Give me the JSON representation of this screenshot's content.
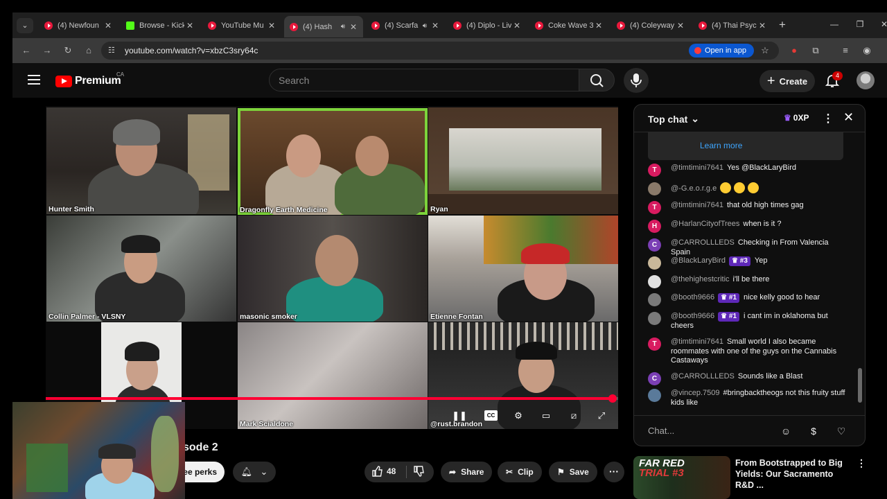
{
  "browser": {
    "tabs": [
      {
        "title": "(4) Newfoun",
        "favicon": "youtube-icon",
        "audio": false
      },
      {
        "title": "Browse - Kick",
        "favicon": "kick-icon",
        "audio": false
      },
      {
        "title": "YouTube Mu",
        "favicon": "youtube-music-icon",
        "audio": false
      },
      {
        "title": "(4) Hash",
        "favicon": "youtube-icon",
        "audio": true,
        "active": true
      },
      {
        "title": "(4) Scarfa",
        "favicon": "youtube-icon",
        "audio": true
      },
      {
        "title": "(4) Diplo - Liv",
        "favicon": "youtube-icon",
        "audio": false
      },
      {
        "title": "Coke Wave 3",
        "favicon": "youtube-music-icon",
        "audio": false
      },
      {
        "title": "(4) Coleyway",
        "favicon": "youtube-icon",
        "audio": false
      },
      {
        "title": "(4) Thai Psych",
        "favicon": "youtube-icon",
        "audio": false
      }
    ],
    "url": "youtube.com/watch?v=xbzC3sry64c",
    "open_in_app": "Open in app"
  },
  "youtube": {
    "logo_text": "Premium",
    "country_code": "CA",
    "search_placeholder": "Search",
    "create_label": "Create",
    "notification_count": "4"
  },
  "video": {
    "participants": [
      "Hunter Smith",
      "Dragonfly Earth Medicine",
      "Ryan",
      "Collin Palmer - VLSNY",
      "masonic smoker",
      "Etienne Fontan",
      "Mark Scialdone",
      "@rust.brandon"
    ],
    "progress_percent": 99,
    "cc_label": "CC",
    "title_fragment": "sode 2"
  },
  "actions": {
    "perks_label": "ee perks",
    "like_count": "48",
    "share_label": "Share",
    "clip_label": "Clip",
    "save_label": "Save"
  },
  "chat": {
    "header": "Top chat",
    "xp": "0XP",
    "learn_more": "Learn more",
    "placeholder": "Chat...",
    "accent": "#9b5cff",
    "messages": [
      {
        "initial": "T",
        "color": "#d81b60",
        "author": "@timtimini7641",
        "badge": "",
        "text": "Yes @BlackLaryBird"
      },
      {
        "initial": "",
        "color": "#8a7a6a",
        "author": "@-G.e.o.r.g.e",
        "badge": "",
        "text": "",
        "emojis": 3
      },
      {
        "initial": "T",
        "color": "#d81b60",
        "author": "@timtimini7641",
        "badge": "",
        "text": "that old high times gag"
      },
      {
        "initial": "H",
        "color": "#d81b60",
        "author": "@HarlanCityofTrees",
        "badge": "",
        "text": "when is it ?"
      },
      {
        "initial": "C",
        "color": "#7b3fb5",
        "author": "@CARROLLLEDS",
        "badge": "",
        "text": "Checking in From Valencia Spain"
      },
      {
        "initial": "",
        "color": "#c9b89a",
        "author": "@BlackLaryBird",
        "badge": "#3",
        "text": "Yep"
      },
      {
        "initial": "",
        "color": "#e0e0e0",
        "author": "@thehighestcritic",
        "badge": "",
        "text": "i'll be there"
      },
      {
        "initial": "",
        "color": "#7a7a7a",
        "author": "@booth9666",
        "badge": "#1",
        "text": "nice kelly good to hear"
      },
      {
        "initial": "",
        "color": "#7a7a7a",
        "author": "@booth9666",
        "badge": "#1",
        "text": "i cant im in oklahoma but cheers"
      },
      {
        "initial": "T",
        "color": "#d81b60",
        "author": "@timtimini7641",
        "badge": "",
        "text": "Small world I also became roommates with one of the guys on the Cannabis Castaways"
      },
      {
        "initial": "C",
        "color": "#7b3fb5",
        "author": "@CARROLLLEDS",
        "badge": "",
        "text": "Sounds like a Blast"
      },
      {
        "initial": "",
        "color": "#5a7a9a",
        "author": "@vincep.7509",
        "badge": "",
        "text": "#bringbacktheogs not this fruity stuff kids like"
      }
    ]
  },
  "related": {
    "thumb_line1": "FAR RED",
    "thumb_line2": "TRIAL #3",
    "title": "From Bootstrapped to Big Yields: Our Sacramento R&D ..."
  }
}
